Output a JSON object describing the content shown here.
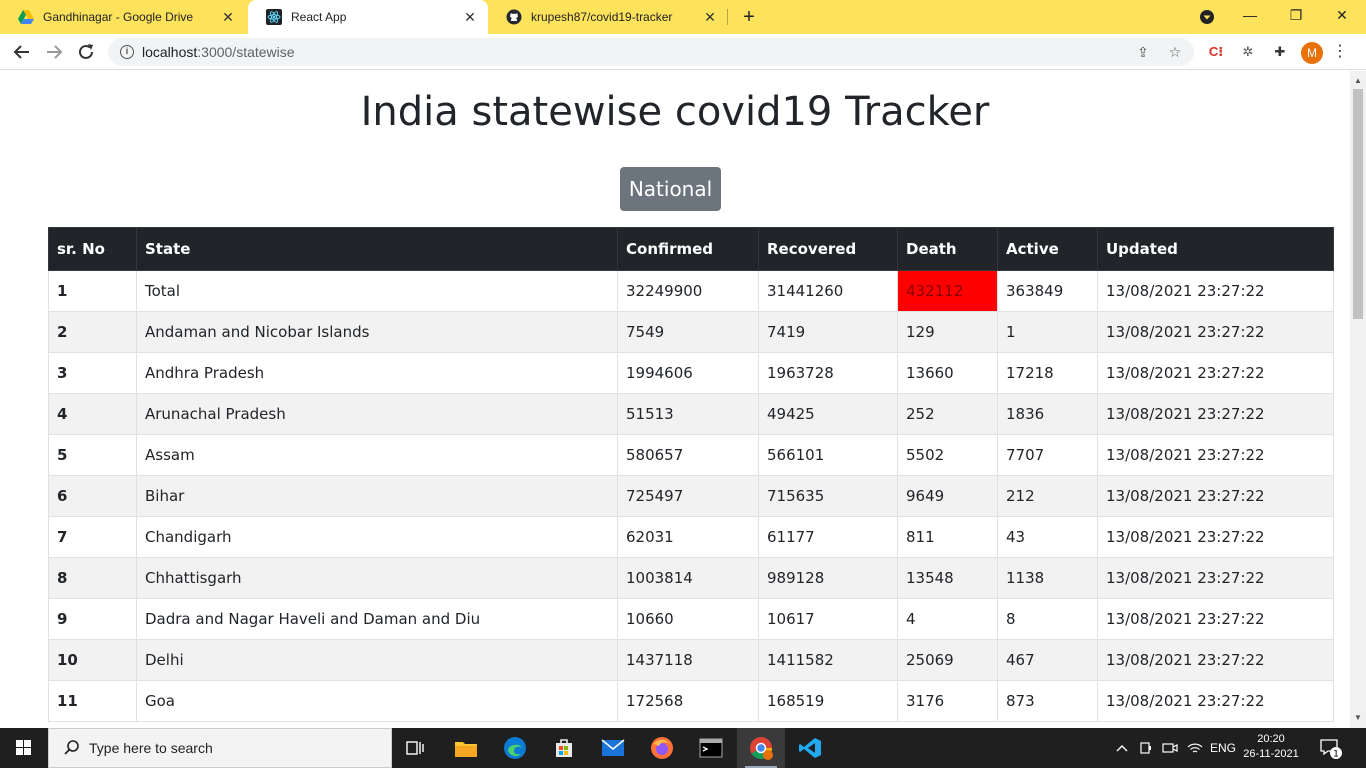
{
  "browser": {
    "tabs": [
      {
        "title": "Gandhinagar - Google Drive",
        "icon": "google-drive-icon",
        "active": false
      },
      {
        "title": "React App",
        "icon": "react-icon",
        "active": true
      },
      {
        "title": "krupesh87/covid19-tracker",
        "icon": "github-icon",
        "active": false
      }
    ],
    "url_host": "localhost",
    "url_path": ":3000/statewise",
    "profile_initial": "M"
  },
  "page": {
    "title": "India statewise covid19 Tracker",
    "national_button": "National"
  },
  "table": {
    "headers": [
      "sr. No",
      "State",
      "Confirmed",
      "Recovered",
      "Death",
      "Active",
      "Updated"
    ],
    "rows": [
      [
        "1",
        "Total",
        "32249900",
        "31441260",
        "432112",
        "363849",
        "13/08/2021 23:27:22"
      ],
      [
        "2",
        "Andaman and Nicobar Islands",
        "7549",
        "7419",
        "129",
        "1",
        "13/08/2021 23:27:22"
      ],
      [
        "3",
        "Andhra Pradesh",
        "1994606",
        "1963728",
        "13660",
        "17218",
        "13/08/2021 23:27:22"
      ],
      [
        "4",
        "Arunachal Pradesh",
        "51513",
        "49425",
        "252",
        "1836",
        "13/08/2021 23:27:22"
      ],
      [
        "5",
        "Assam",
        "580657",
        "566101",
        "5502",
        "7707",
        "13/08/2021 23:27:22"
      ],
      [
        "6",
        "Bihar",
        "725497",
        "715635",
        "9649",
        "212",
        "13/08/2021 23:27:22"
      ],
      [
        "7",
        "Chandigarh",
        "62031",
        "61177",
        "811",
        "43",
        "13/08/2021 23:27:22"
      ],
      [
        "8",
        "Chhattisgarh",
        "1003814",
        "989128",
        "13548",
        "1138",
        "13/08/2021 23:27:22"
      ],
      [
        "9",
        "Dadra and Nagar Haveli and Daman and Diu",
        "10660",
        "10617",
        "4",
        "8",
        "13/08/2021 23:27:22"
      ],
      [
        "10",
        "Delhi",
        "1437118",
        "1411582",
        "25069",
        "467",
        "13/08/2021 23:27:22"
      ],
      [
        "11",
        "Goa",
        "172568",
        "168519",
        "3176",
        "873",
        "13/08/2021 23:27:22"
      ]
    ],
    "highlight_color": "#ff0000"
  },
  "taskbar": {
    "search_placeholder": "Type here to search",
    "language": "ENG",
    "time": "20:20",
    "date": "26-11-2021",
    "notification_count": "1"
  }
}
